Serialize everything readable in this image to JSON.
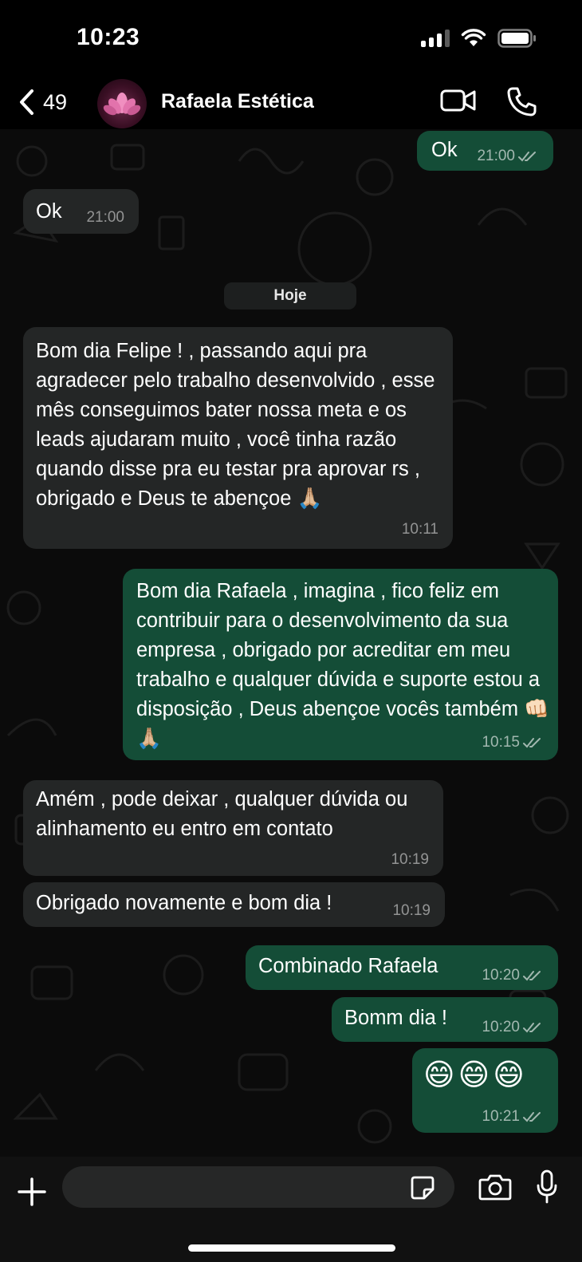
{
  "status_bar": {
    "time": "10:23"
  },
  "header": {
    "back_count": "49",
    "contact_name": "Rafaela Estética"
  },
  "chat": {
    "date_separator": "Hoje",
    "messages": [
      {
        "direction": "out",
        "text": "Ok",
        "time": "21:00",
        "read": true
      },
      {
        "direction": "in",
        "text": "Ok",
        "time": "21:00"
      },
      {
        "direction": "in",
        "text": "Bom dia Felipe ! , passando aqui pra agradecer pelo trabalho desenvolvido , esse mês conseguimos bater nossa meta e os leads ajudaram muito , você tinha razão quando disse pra eu testar pra aprovar rs , obrigado e Deus te abençoe 🙏🏼",
        "time": "10:11"
      },
      {
        "direction": "out",
        "text": "Bom dia Rafaela , imagina , fico feliz em contribuir para o desenvolvimento da sua empresa , obrigado por acreditar em meu trabalho e qualquer dúvida e suporte estou a disposição , Deus abençoe vocês também 👊🏻🙏🏼",
        "time": "10:15",
        "read": true
      },
      {
        "direction": "in",
        "text": "Amém , pode deixar , qualquer dúvida ou alinhamento eu entro em contato",
        "time": "10:19"
      },
      {
        "direction": "in",
        "text": "Obrigado novamente e bom dia !",
        "time": "10:19"
      },
      {
        "direction": "out",
        "text": "Combinado Rafaela",
        "time": "10:20",
        "read": true
      },
      {
        "direction": "out",
        "text": "Bomm dia !",
        "time": "10:20",
        "read": true
      },
      {
        "direction": "out",
        "text": "😄😄😄",
        "time": "10:21",
        "read": true
      }
    ]
  },
  "composer": {
    "input_value": ""
  },
  "icons": {
    "back": "chevron-left-icon",
    "video": "video-camera-icon",
    "call": "phone-icon",
    "plus": "plus-icon",
    "sticker": "sticker-icon",
    "camera": "camera-icon",
    "mic": "microphone-icon"
  },
  "colors": {
    "incoming_bubble": "#242626",
    "outgoing_bubble": "#144d37",
    "background": "#0b0b0b"
  }
}
